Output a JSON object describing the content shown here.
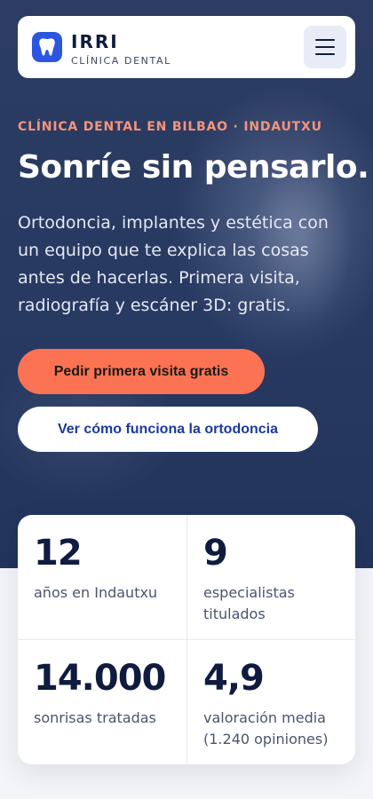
{
  "header": {
    "brand_name": "IRRI",
    "brand_sub": "CLÍNICA DENTAL",
    "logo_icon": "tooth-icon",
    "menu_icon": "hamburger-menu-icon"
  },
  "hero": {
    "eyebrow": "CLÍNICA DENTAL EN BILBAO · INDAUTXU",
    "title": "Sonríe sin pensarlo.",
    "description": "Ortodoncia, implantes y estética con un equipo que te explica las cosas antes de hacerlas. Primera visita, radiografía y escáner 3D: gratis.",
    "primary_cta": "Pedir primera visita gratis",
    "secondary_cta": "Ver cómo funciona la ortodoncia"
  },
  "stats": [
    {
      "value": "12",
      "label": "años en Indautxu"
    },
    {
      "value": "9",
      "label": "especialistas titulados"
    },
    {
      "value": "14.000",
      "label": "sonrisas tratadas"
    },
    {
      "value": "4,9",
      "label": "valoración media (1.240 opiniones)"
    }
  ],
  "colors": {
    "accent": "#fb7352",
    "brand": "#2b57e0",
    "hero_bg": "#283a62",
    "eyebrow": "#f6937a",
    "link": "#1c3a9c"
  }
}
